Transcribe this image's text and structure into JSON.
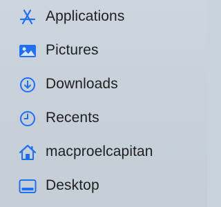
{
  "sidebar": {
    "accent_color": "#1f6ff0",
    "items": [
      {
        "label": "Applications",
        "icon": "applications-icon"
      },
      {
        "label": "Pictures",
        "icon": "pictures-icon"
      },
      {
        "label": "Downloads",
        "icon": "downloads-icon"
      },
      {
        "label": "Recents",
        "icon": "recents-icon"
      },
      {
        "label": "macproelcapitan",
        "icon": "home-icon"
      },
      {
        "label": "Desktop",
        "icon": "desktop-icon"
      }
    ]
  }
}
